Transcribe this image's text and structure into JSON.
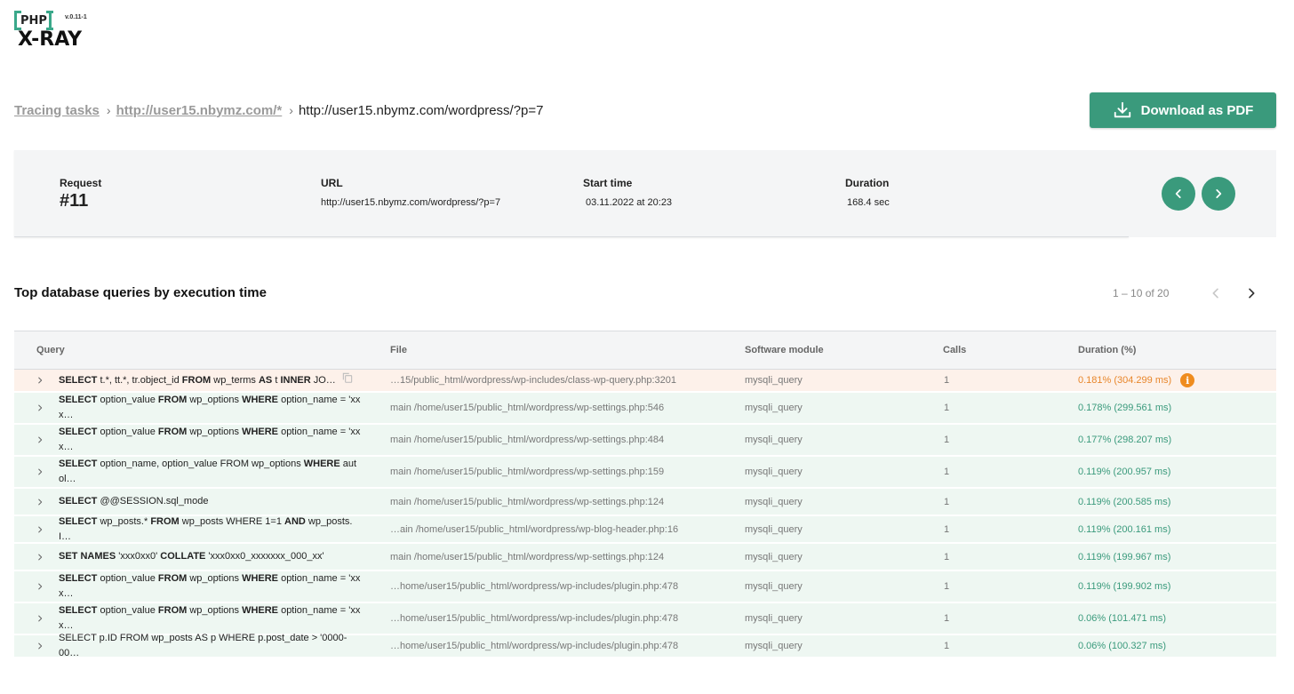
{
  "logo": {
    "php": "PHP",
    "version": "v.0.11-1",
    "product": "X-RAY"
  },
  "breadcrumb": {
    "items": [
      "Tracing tasks",
      "http://user15.nbymz.com/*"
    ],
    "current": "http://user15.nbymz.com/wordpress/?p=7"
  },
  "toolbar": {
    "download_label": "Download as PDF"
  },
  "summary": {
    "request_label": "Request",
    "request_value": "#11",
    "url_label": "URL",
    "url_value": "http://user15.nbymz.com/wordpress/?p=7",
    "start_label": "Start time",
    "start_value": "03.11.2022 at 20:23",
    "duration_label": "Duration",
    "duration_value": "168.4 sec"
  },
  "section": {
    "title": "Top database queries by execution time",
    "pager": "1 – 10 of 20"
  },
  "table": {
    "headers": [
      "Query",
      "File",
      "Software module",
      "Calls",
      "Duration (%)"
    ],
    "rows": [
      {
        "query": [
          "SELECT",
          " t.*, tt.*, tr.object_id ",
          "FROM",
          " wp_terms ",
          "AS",
          " t  ",
          "INNER",
          " JO…"
        ],
        "file": "…15/public_html/wordpress/wp-includes/class-wp-query.php:3201",
        "module": "mysqli_query",
        "calls": "1",
        "duration": "0.181% (304.299 ms)",
        "highlight": true
      },
      {
        "query": [
          "SELECT",
          " option_value ",
          "FROM",
          " wp_options ",
          "WHERE",
          " option_name = 'xx x…"
        ],
        "file": "main /home/user15/public_html/wordpress/wp-settings.php:546",
        "module": "mysqli_query",
        "calls": "1",
        "duration": "0.178% (299.561 ms)"
      },
      {
        "query": [
          "SELECT",
          " option_value ",
          "FROM",
          " wp_options ",
          "WHERE",
          " option_name = 'xx x…"
        ],
        "file": "main /home/user15/public_html/wordpress/wp-settings.php:484",
        "module": "mysqli_query",
        "calls": "1",
        "duration": "0.177% (298.207 ms)"
      },
      {
        "query": [
          "SELECT",
          " option_name, option_value FROM wp_options ",
          "WHERE",
          " aut ol…"
        ],
        "file": "main /home/user15/public_html/wordpress/wp-settings.php:159",
        "module": "mysqli_query",
        "calls": "1",
        "duration": "0.119% (200.957 ms)"
      },
      {
        "query": [
          "SELECT",
          " @@SESSION.sql_mode"
        ],
        "file": "main /home/user15/public_html/wordpress/wp-settings.php:124",
        "module": "mysqli_query",
        "calls": "1",
        "duration": "0.119% (200.585 ms)"
      },
      {
        "query": [
          "SELECT",
          "   wp_posts.* ",
          "FROM",
          " wp_posts  WHERE 1=1  ",
          "AND",
          " wp_posts. I…"
        ],
        "file": "…ain /home/user15/public_html/wordpress/wp-blog-header.php:16",
        "module": "mysqli_query",
        "calls": "1",
        "duration": "0.119% (200.161 ms)"
      },
      {
        "query": [
          "SET NAMES",
          " 'xxx0xx0' ",
          "COLLATE",
          " 'xxx0xx0_xxxxxxx_000_xx'"
        ],
        "file": "main /home/user15/public_html/wordpress/wp-settings.php:124",
        "module": "mysqli_query",
        "calls": "1",
        "duration": "0.119% (199.967 ms)"
      },
      {
        "query": [
          "SELECT",
          " option_value ",
          "FROM",
          " wp_options ",
          "WHERE",
          " option_name = 'xx x…"
        ],
        "file": "…home/user15/public_html/wordpress/wp-includes/plugin.php:478",
        "module": "mysqli_query",
        "calls": "1",
        "duration": "0.119% (199.902 ms)"
      },
      {
        "query": [
          "SELECT",
          " option_value ",
          "FROM",
          " wp_options ",
          "WHERE",
          " option_name = 'xx x…"
        ],
        "file": "…home/user15/public_html/wordpress/wp-includes/plugin.php:478",
        "module": "mysqli_query",
        "calls": "1",
        "duration": "0.06% (101.471 ms)"
      },
      {
        "query": [
          "",
          "SELECT p.ID FROM wp_posts AS p  WHERE p.post_date > '0000-00…"
        ],
        "file": "…home/user15/public_html/wordpress/wp-includes/plugin.php:478",
        "module": "mysqli_query",
        "calls": "1",
        "duration": "0.06% (100.327 ms)"
      }
    ]
  },
  "colors": {
    "accent": "#3a9a7c",
    "warning": "#e8862a",
    "row_bg": "#eef7f2",
    "row_highlight_bg": "#fdf1ea"
  },
  "icons": [
    "download-icon",
    "chevron-left-icon",
    "chevron-right-icon",
    "chevron-right-icon",
    "copy-icon",
    "info-icon"
  ]
}
